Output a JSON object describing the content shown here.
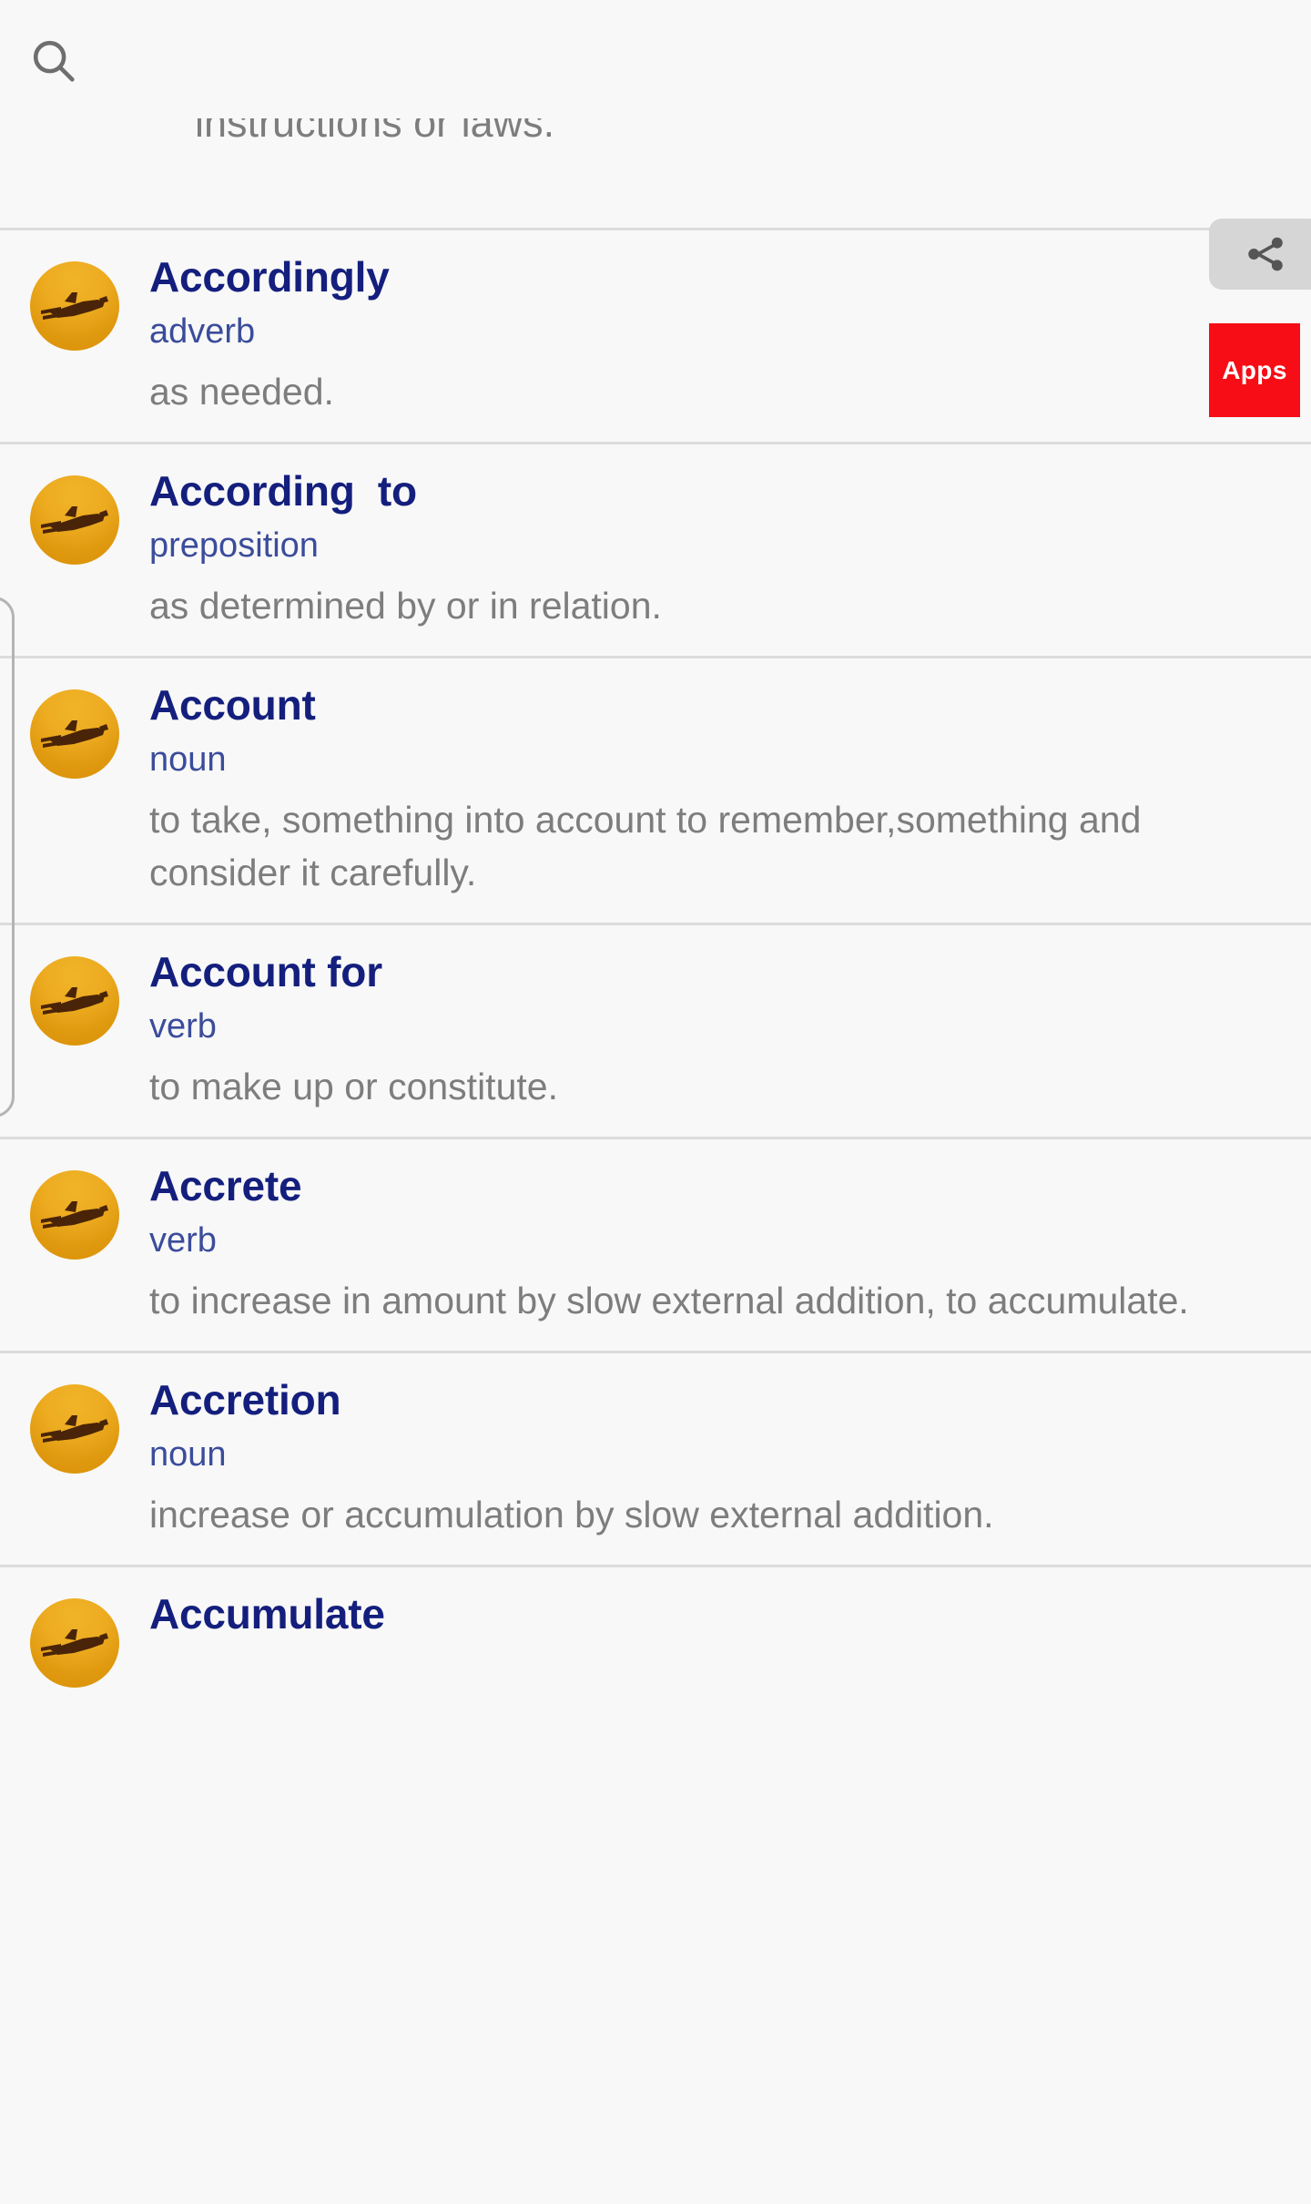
{
  "app": {
    "background_color": "#f8f8f8",
    "title_color": "#141f7d",
    "pos_color": "#3b4c9b",
    "definition_color": "#7d7d7d",
    "divider_color": "#dcdcdc",
    "accent_red": "#f60d15"
  },
  "topbar": {
    "search_icon": "search-icon",
    "search_placeholder": ""
  },
  "clipped_entry": {
    "definition_fragment": "instructions or laws."
  },
  "overlay": {
    "share_icon": "share-icon",
    "apps_label": "Apps"
  },
  "list": {
    "thumbnail_icon": "airplane-sunset-thumbnail",
    "entries": [
      {
        "word": "Accordingly",
        "pos": "adverb",
        "definition": "as needed."
      },
      {
        "word": "According  to",
        "pos": "preposition",
        "definition": "as determined by or in relation."
      },
      {
        "word": "Account",
        "pos": "noun",
        "definition": "to take, something into account to remember,something and consider it carefully."
      },
      {
        "word": "Account for",
        "pos": "verb",
        "definition": "to make up or constitute."
      },
      {
        "word": "Accrete",
        "pos": "verb",
        "definition": "to increase in amount by slow external addition, to accumulate."
      },
      {
        "word": "Accretion",
        "pos": "noun",
        "definition": "increase or accumulation by slow external addition."
      },
      {
        "word": "Accumulate",
        "pos": "",
        "definition": ""
      }
    ]
  }
}
